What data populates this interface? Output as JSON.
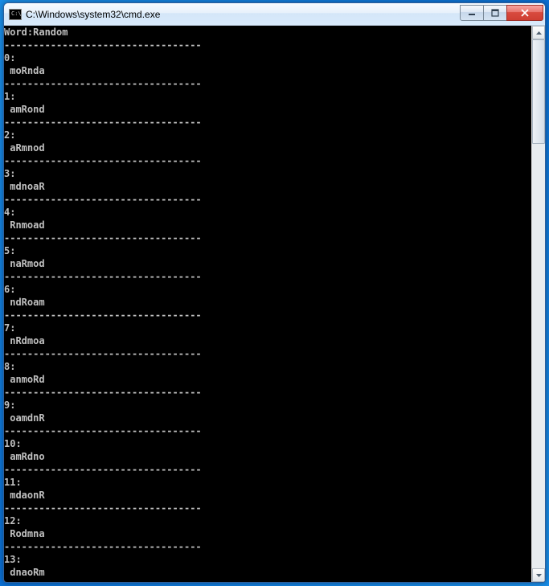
{
  "window": {
    "title": "C:\\Windows\\system32\\cmd.exe"
  },
  "console": {
    "header": "Word:Random",
    "divider": "----------------------------------",
    "items": [
      {
        "index": "0:",
        "text": " moRnda"
      },
      {
        "index": "1:",
        "text": " amRond"
      },
      {
        "index": "2:",
        "text": " aRmnod"
      },
      {
        "index": "3:",
        "text": " mdnoaR"
      },
      {
        "index": "4:",
        "text": " Rnmoad"
      },
      {
        "index": "5:",
        "text": " naRmod"
      },
      {
        "index": "6:",
        "text": " ndRoam"
      },
      {
        "index": "7:",
        "text": " nRdmoa"
      },
      {
        "index": "8:",
        "text": " anmoRd"
      },
      {
        "index": "9:",
        "text": " oamdnR"
      },
      {
        "index": "10:",
        "text": " amRdno"
      },
      {
        "index": "11:",
        "text": " mdaonR"
      },
      {
        "index": "12:",
        "text": " Rodmna"
      },
      {
        "index": "13:",
        "text": " dnaoRm"
      }
    ]
  }
}
